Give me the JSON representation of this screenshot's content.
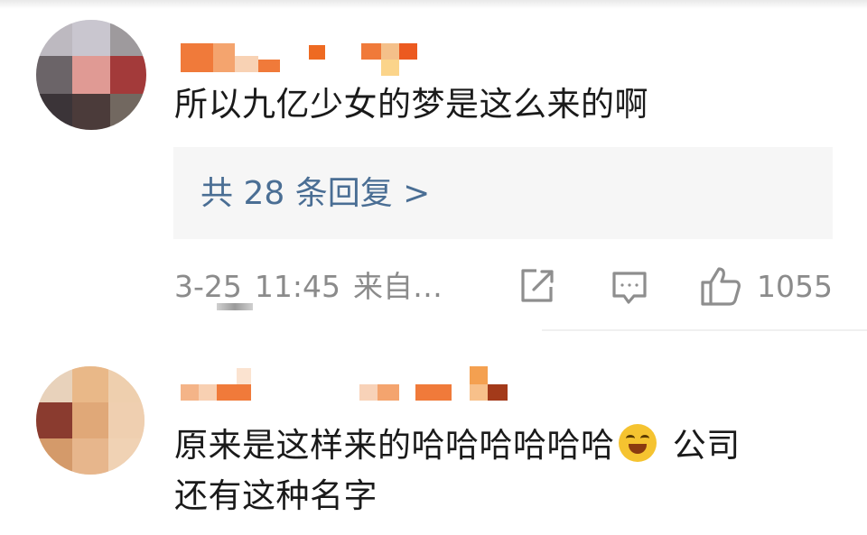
{
  "comments": [
    {
      "text": "所以九亿少女的梦是这么来的啊",
      "replies_label": "共 28 条回复 >",
      "date": "3-25",
      "time": "11:45",
      "source": "来自…",
      "likes": "1055"
    },
    {
      "text_part1": "原来是这样来的哈哈哈哈哈哈",
      "text_part2": " 公司",
      "text_line2": "还有这种名字",
      "emoji": "laughing-crying-emoji"
    }
  ],
  "colors": {
    "reply_link": "#4a6e94",
    "meta": "#8b8b8b",
    "text": "#1a1a1a",
    "reply_bg": "#f6f6f6"
  },
  "icons": {
    "share": "share-icon",
    "comment": "comment-icon",
    "like": "thumbs-up-icon"
  }
}
